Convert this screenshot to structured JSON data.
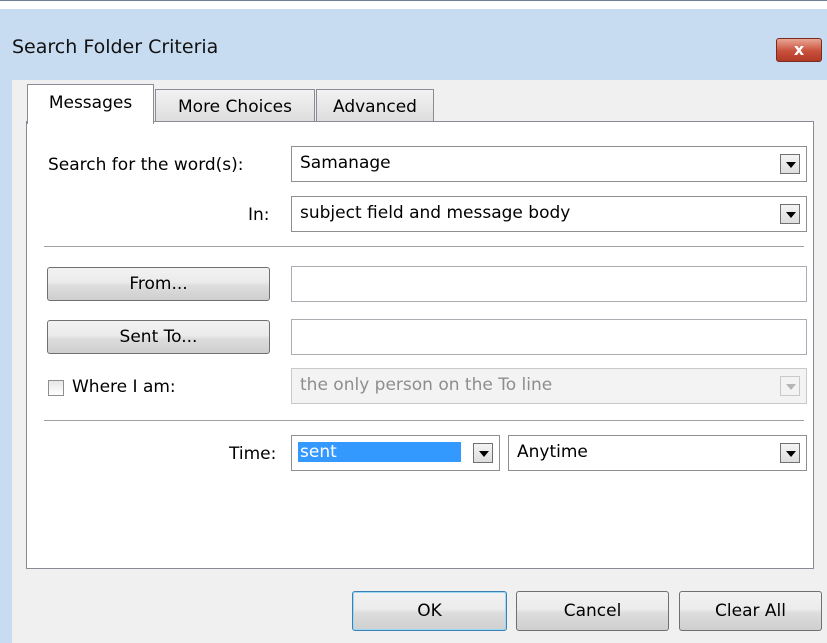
{
  "window": {
    "title": "Search Folder Criteria",
    "close_glyph": "x"
  },
  "tabs": [
    {
      "label": "Messages",
      "active": true
    },
    {
      "label": "More Choices",
      "active": false
    },
    {
      "label": "Advanced",
      "active": false
    }
  ],
  "messages": {
    "search_label": "Search for the word(s):",
    "search_value": "Samanage",
    "in_label": "In:",
    "in_value": "subject field and message body",
    "from_button": "From...",
    "from_value": "",
    "sent_to_button": "Sent To...",
    "sent_to_value": "",
    "where_label": "Where I am:",
    "where_checked": false,
    "where_value": "the only person on the To line",
    "time_label": "Time:",
    "time_type_value": "sent",
    "time_range_value": "Anytime"
  },
  "buttons": {
    "ok": "OK",
    "cancel": "Cancel",
    "clear_all": "Clear All"
  },
  "colors": {
    "frame": "#c7dcf1",
    "close": "#c9503b",
    "selection": "#3399ff",
    "default_border": "#3c7fb1"
  }
}
